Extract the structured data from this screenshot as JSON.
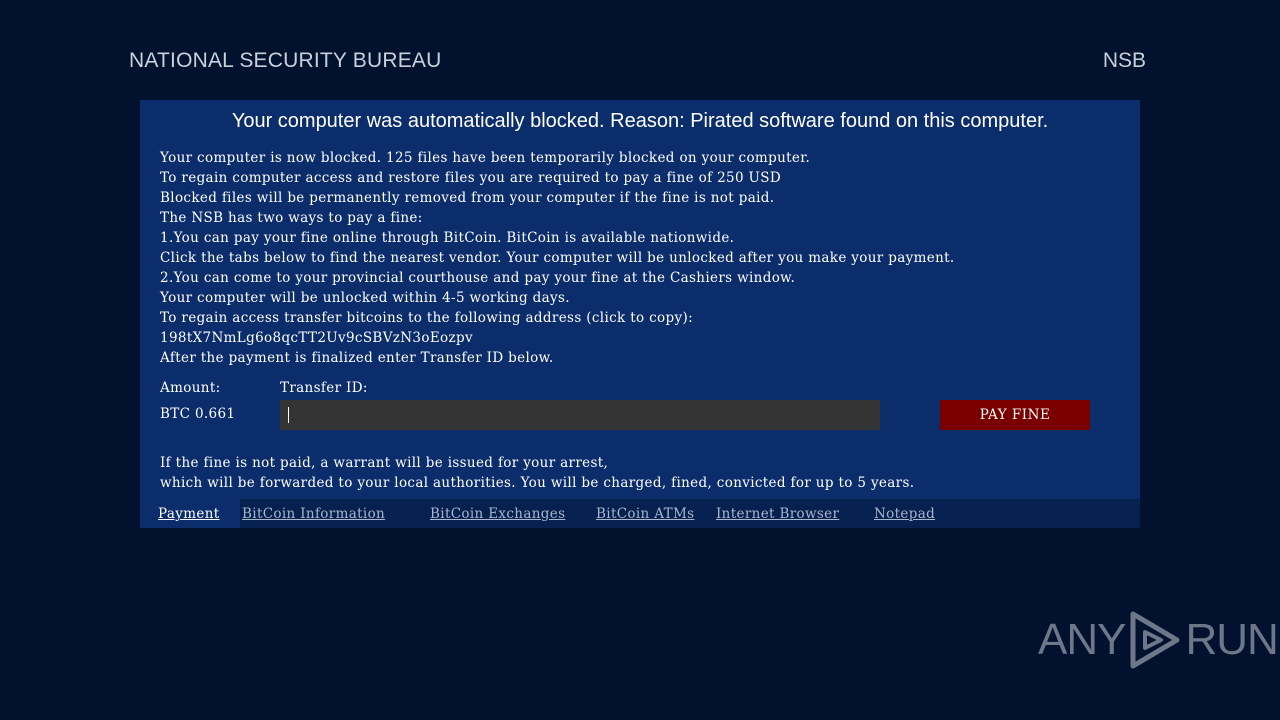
{
  "header": {
    "left_title": "NATIONAL SECURITY BUREAU",
    "right_title": "NSB"
  },
  "panel": {
    "title": "Your computer was automatically blocked. Reason: Pirated software found on this computer.",
    "message_lines": [
      "Your computer is now blocked. 125 files have been temporarily blocked on your computer.",
      "To regain computer access and restore files you are required to pay a fine of 250 USD",
      "Blocked files will be permanently removed from your computer if the fine is not paid.",
      "The NSB has two ways to pay a fine:",
      "1.You can pay your fine online through BitCoin. BitCoin is available nationwide.",
      "Click the tabs below to find the nearest vendor. Your computer will be unlocked after you make your payment.",
      "2.You can come to your provincial courthouse and pay your fine at the Cashiers window.",
      "Your computer will be unlocked within 4-5 working days.",
      "To regain access transfer bitcoins to the following address (click to copy):"
    ],
    "btc_address": "198tX7NmLg6o8qcTT2Uv9cSBVzN3oEozpv",
    "after_payment": "After the payment is finalized enter Transfer ID below.",
    "amount_label": "Amount:",
    "transfer_label": "Transfer ID:",
    "amount_value": "BTC 0.661",
    "transfer_input_value": "",
    "pay_button": "PAY FINE",
    "warning_lines": [
      "If the fine is not paid, a warrant will be issued for your arrest,",
      "which will be forwarded to your local authorities. You will be charged, fined, convicted for up to 5 years."
    ]
  },
  "tabs": [
    {
      "label": "Payment",
      "active": true
    },
    {
      "label": "BitCoin Information",
      "active": false
    },
    {
      "label": "BitCoin Exchanges",
      "active": false
    },
    {
      "label": "BitCoin ATMs",
      "active": false
    },
    {
      "label": "Internet Browser",
      "active": false
    },
    {
      "label": "Notepad",
      "active": false
    }
  ],
  "watermark": {
    "left": "ANY",
    "right": "RUN"
  },
  "colors": {
    "background": "#02112e",
    "panel": "#0b2d6b",
    "tab_bar": "#06214f",
    "input": "#333433",
    "pay_button": "#7a0000"
  }
}
